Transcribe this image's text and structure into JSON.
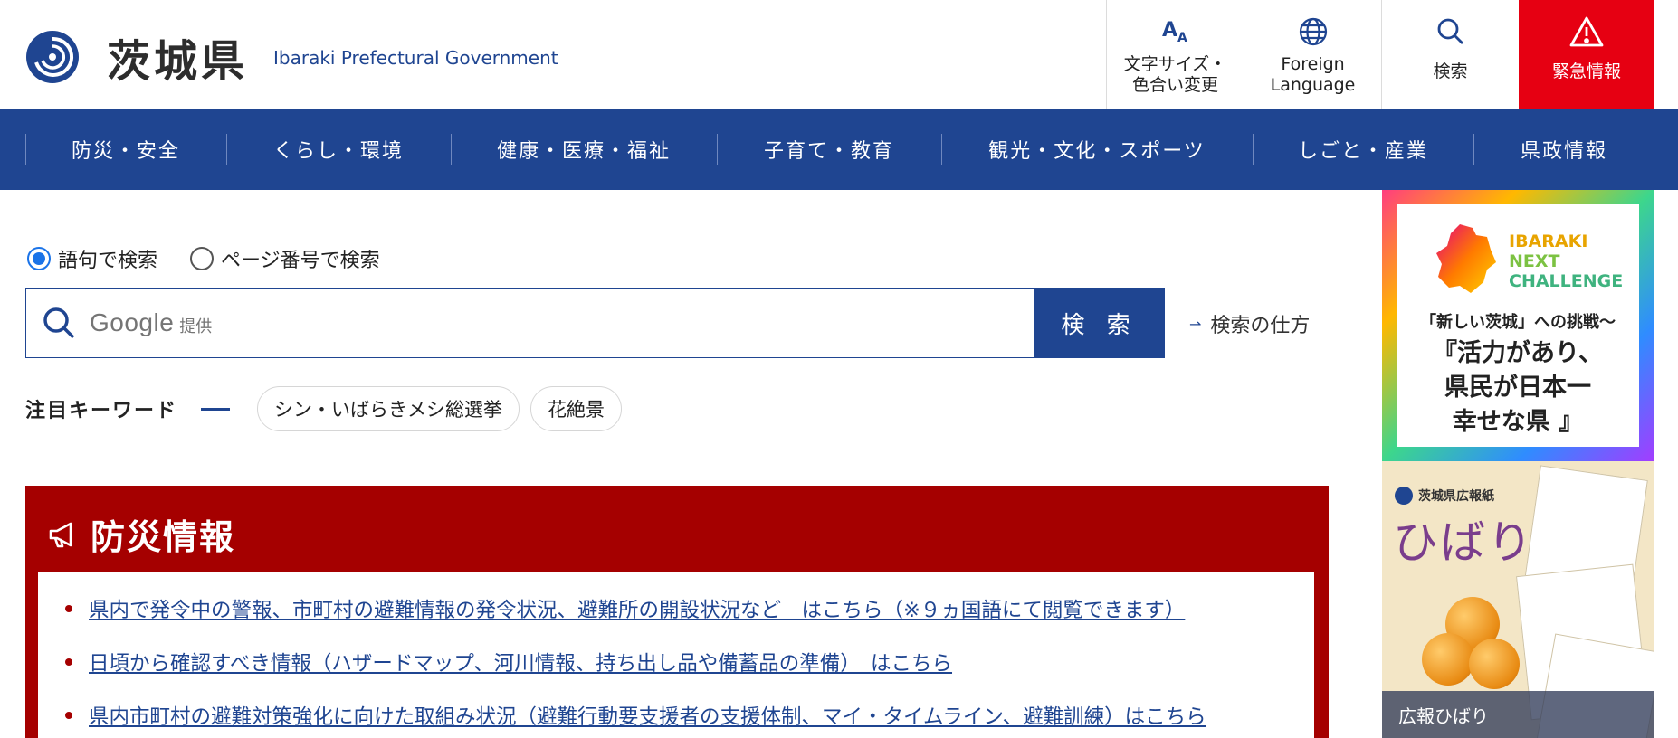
{
  "header": {
    "site_title": "茨城県",
    "site_subtitle": "Ibaraki Prefectural Government",
    "util": [
      {
        "icon": "font-size-icon",
        "label": "文字サイズ・\n色合い変更"
      },
      {
        "icon": "globe-icon",
        "label": "Foreign\nLanguage"
      },
      {
        "icon": "search-icon",
        "label": "検索"
      },
      {
        "icon": "warning-icon",
        "label": "緊急情報"
      }
    ],
    "emergency_color": "#e60012",
    "brand_color": "#1f4591"
  },
  "gnav": {
    "items": [
      "防災・安全",
      "くらし・環境",
      "健康・医療・福祉",
      "子育て・教育",
      "観光・文化・スポーツ",
      "しごと・産業",
      "県政情報"
    ]
  },
  "search": {
    "radio_options": [
      "語句で検索",
      "ページ番号で検索"
    ],
    "selected": "語句で検索",
    "google_text": "Google",
    "google_sub": "提供",
    "button_label": "検 索",
    "howto_label": "検索の仕方"
  },
  "keywords": {
    "label": "注目キーワード",
    "chips": [
      "シン・いばらきメシ総選挙",
      "花絶景"
    ]
  },
  "bousai": {
    "title": "防災情報",
    "links": [
      "県内で発令中の警報、市町村の避難情報の発令状況、避難所の開設状況など　はこちら（※９ヵ国語にて閲覧できます）",
      "日頃から確認すべき情報（ハザードマップ、河川情報、持ち出し品や備蓄品の準備）　はこちら",
      "県内市町村の避難対策強化に向けた取組み状況（避難行動要支援者の支援体制、マイ・タイムライン、避難訓練）はこちら"
    ]
  },
  "banners": {
    "next_challenge": {
      "word": [
        "IBARAKI",
        "NEXT",
        "CHALLENGE"
      ],
      "catch": "「新しい茨城」への挑戦〜",
      "main": [
        "『活力があり、",
        "県民が日本一",
        "幸せな県 』"
      ]
    },
    "hibari": {
      "brand": "茨城県広報紙",
      "title": "ひばり",
      "caption": "広報ひばり"
    }
  }
}
